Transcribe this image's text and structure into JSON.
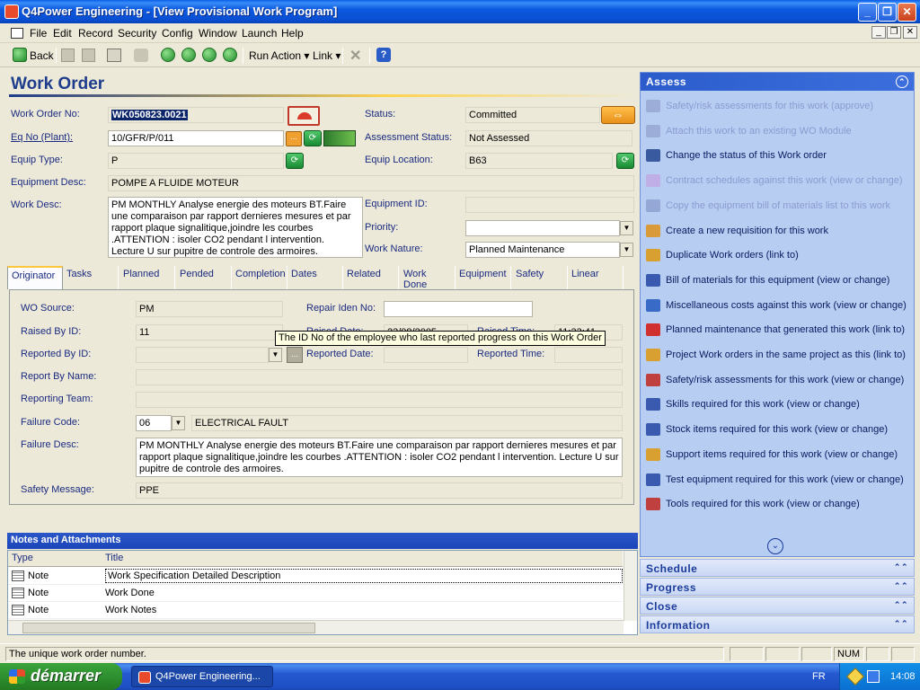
{
  "window": {
    "title": "Q4Power Engineering - [View Provisional Work Program]",
    "controls": {
      "minimize": "_",
      "restore": "❐",
      "close": "✕"
    }
  },
  "menu": {
    "items": [
      "File",
      "Edit",
      "Record",
      "Security",
      "Config",
      "Window",
      "Launch",
      "Help"
    ],
    "mdi": {
      "minimize": "_",
      "restore": "❐",
      "close": "✕"
    }
  },
  "toolbar": {
    "back_label": "Back",
    "run_action_label": "Run Action",
    "link_label": "Link"
  },
  "form": {
    "title": "Work Order",
    "work_order_no_label": "Work Order No:",
    "work_order_no": "WK050823.0021",
    "status_label": "Status:",
    "status": "Committed",
    "eq_no_label": "Eq No (Plant):",
    "eq_no": "10/GFR/P/011",
    "assessment_status_label": "Assessment Status:",
    "assessment_status": "Not Assessed",
    "equip_type_label": "Equip Type:",
    "equip_type": "P",
    "equip_location_label": "Equip Location:",
    "equip_location": "B63",
    "equipment_desc_label": "Equipment Desc:",
    "equipment_desc": "POMPE A FLUIDE MOTEUR",
    "work_desc_label": "Work Desc:",
    "work_desc": "PM MONTHLY  Analyse energie des moteurs BT.Faire une comparaison par rapport dernieres mesures et par rapport  plaque signalitique,joindre les courbes .ATTENTION : isoler CO2 pendant l intervention. Lecture U sur pupitre de controle des armoires.",
    "equipment_id_label": "Equipment ID:",
    "equipment_id": "",
    "priority_label": "Priority:",
    "priority": "",
    "work_nature_label": "Work Nature:",
    "work_nature": "Planned Maintenance"
  },
  "tabs": [
    "Originator",
    "Tasks",
    "Planned",
    "Pended",
    "Completion",
    "Dates",
    "Related",
    "Work Done",
    "Equipment",
    "Safety",
    "Linear"
  ],
  "originator": {
    "wo_source_label": "WO Source:",
    "wo_source": "PM",
    "repair_iden_label": "Repair Iden No:",
    "repair_iden": "",
    "raised_by_label": "Raised By ID:",
    "raised_by": "11",
    "raised_date_label": "Raised Date:",
    "raised_date": "23/08/2005",
    "raised_time_label": "Raised Time:",
    "raised_time": "11:33:41",
    "reported_by_label": "Reported By ID:",
    "reported_by": "",
    "reported_date_label": "Reported Date:",
    "reported_date": "",
    "reported_time_label": "Reported Time:",
    "reported_time": "",
    "report_by_name_label": "Report By Name:",
    "report_by_name": "",
    "reporting_team_label": "Reporting Team:",
    "reporting_team": "",
    "failure_code_label": "Failure Code:",
    "failure_code": "06",
    "failure_code_desc": "ELECTRICAL FAULT",
    "failure_desc_label": "Failure Desc:",
    "failure_desc": "PM MONTHLY  Analyse energie des moteurs BT.Faire une comparaison par rapport dernieres mesures et par rapport  plaque signalitique,joindre les courbes .ATTENTION : isoler CO2 pendant l intervention. Lecture U sur pupitre de controle des armoires.",
    "safety_message_label": "Safety Message:",
    "safety_message": "PPE",
    "ellipsis": "..."
  },
  "tooltip": "The ID No of the employee who last reported progress on this Work Order",
  "notes": {
    "header": "Notes and Attachments",
    "columns": [
      "Type",
      "Title"
    ],
    "rows": [
      {
        "type": "Note",
        "title": "Work Specification Detailed Description"
      },
      {
        "type": "Note",
        "title": "Work Done"
      },
      {
        "type": "Note",
        "title": "Work Notes"
      }
    ]
  },
  "assess": {
    "header": "Assess",
    "items": [
      {
        "label": "Safety/risk assessments for this work (approve)",
        "disabled": true
      },
      {
        "label": "Attach this work to an existing WO Module",
        "disabled": true
      },
      {
        "label": "Change the status of this Work order",
        "disabled": false
      },
      {
        "label": "Contract schedules against this work (view or change)",
        "disabled": true
      },
      {
        "label": "Copy the equipment bill of materials list to this work",
        "disabled": true
      },
      {
        "label": "Create a new requisition for this work",
        "disabled": false
      },
      {
        "label": "Duplicate Work orders (link to)",
        "disabled": false
      },
      {
        "label": "Bill of materials for this equipment (view or change)",
        "disabled": false
      },
      {
        "label": "Miscellaneous costs against this work (view or change)",
        "disabled": false
      },
      {
        "label": "Planned maintenance that generated this work (link to)",
        "disabled": false
      },
      {
        "label": "Project Work orders in the same project as this (link to)",
        "disabled": false
      },
      {
        "label": "Safety/risk assessments for this work (view or change)",
        "disabled": false
      },
      {
        "label": "Skills required for this work (view or change)",
        "disabled": false
      },
      {
        "label": "Stock items required for this work (view or change)",
        "disabled": false
      },
      {
        "label": "Support items required for this work (view or change)",
        "disabled": false
      },
      {
        "label": "Test equipment required for this work (view or change)",
        "disabled": false
      },
      {
        "label": "Tools required for this work (view or change)",
        "disabled": false
      }
    ]
  },
  "panels": [
    "Schedule",
    "Progress",
    "Close",
    "Information"
  ],
  "statusbar": {
    "text": "The unique work order number.",
    "num": "NUM"
  },
  "taskbar": {
    "start": "démarrer",
    "task": "Q4Power Engineering...",
    "lang": "FR",
    "clock": "14:08"
  },
  "colors": {
    "title_bar": "#0a4fd2",
    "form_title": "#1e3c8c",
    "assess_bg": "#b8cdf2",
    "start_green": "#2f8f2f"
  }
}
